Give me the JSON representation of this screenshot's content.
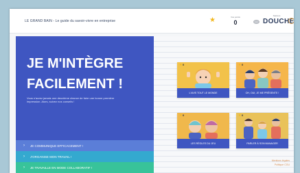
{
  "app": {
    "title": "LE GRAND BAIN - Le guide du savoir-vivre en entreprise"
  },
  "header": {
    "points_label": "Vos points",
    "points_value": "0",
    "station_label": "Stations",
    "station_value": "DOUCHE",
    "help_icon_glyph": "?"
  },
  "hero": {
    "title": "JE M'INTÈGRE FACILEMENT !",
    "text": "Vous n'aurez jamais une deuxième chance de faire une bonne première impression. Alors, suivez nos conseils !"
  },
  "menu": [
    {
      "label": "JE COMMUNIQUE EFFICACEMENT !",
      "chevron": "›"
    },
    {
      "label": "J'ORGANISE MON TRAVAIL !",
      "chevron": "›"
    },
    {
      "label": "JE TRAVAILLE EN MODE COLLABORATIF !",
      "chevron": "›"
    }
  ],
  "cards": [
    {
      "caption": "L'AVIS TOUT LE MONDE",
      "points": "0"
    },
    {
      "caption": "OH, OUI, JE ME PRÉSENTE !",
      "points": "0"
    },
    {
      "caption": "LES RÈGLES DU JEU",
      "points": "0"
    },
    {
      "caption": "PARLER À SON MANAGER",
      "points": "0"
    }
  ],
  "footer": {
    "link1": "Mentions légales",
    "link2": "Politique CGU"
  },
  "colors": {
    "primary": "#3f56c1",
    "menu1": "#5b7ed8",
    "menu2": "#34a9cf",
    "menu3": "#38c39a",
    "accent": "#f2b71c"
  },
  "icons": [
    "star-icon",
    "soap-icon",
    "help-icon",
    "chevron-right-icon"
  ]
}
